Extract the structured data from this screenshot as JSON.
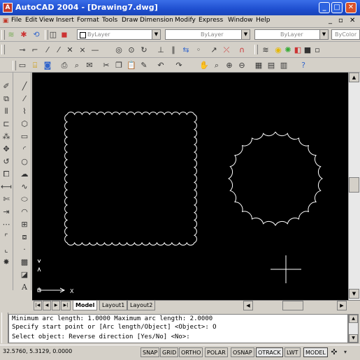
{
  "window": {
    "title": "AutoCAD 2004 - [Drawing7.dwg]",
    "min_label": "_",
    "max_label": "□",
    "close_label": "✕"
  },
  "menu": {
    "items": [
      "File",
      "Edit",
      "View",
      "Insert",
      "Format",
      "Tools",
      "Draw",
      "Dimension",
      "Modify",
      "Express",
      "Window",
      "Help"
    ],
    "doc_min": "_",
    "doc_restore": "▫",
    "doc_close": "✕"
  },
  "properties": {
    "layer": "ByLayer",
    "linetype": "ByLayer",
    "lineweight": "ByLayer",
    "color": "ByColor"
  },
  "layout_tabs": {
    "nav": [
      "|◀",
      "◀",
      "▶",
      "▶|"
    ],
    "tabs": [
      "Model",
      "Layout1",
      "Layout2"
    ]
  },
  "command": {
    "lines": [
      "Minimum arc length: 1.0000   Maximum arc length: 2.0000",
      "Specify start point or [Arc length/Object] <Object>: O",
      "Select object: Reverse direction [Yes/No] <No>:"
    ]
  },
  "status": {
    "coords": "32.5760, 5.3129, 0.0000",
    "toggles": [
      "SNAP",
      "GRID",
      "ORTHO",
      "POLAR",
      "OSNAP",
      "OTRACK",
      "LWT",
      "MODEL"
    ]
  },
  "ucs": {
    "x_label": "X",
    "y_label": "Y"
  },
  "colors": {
    "titlebar": "#1f4fd0",
    "canvas": "#000000",
    "entity": "#ffffff",
    "chrome": "#d4d0c8"
  }
}
